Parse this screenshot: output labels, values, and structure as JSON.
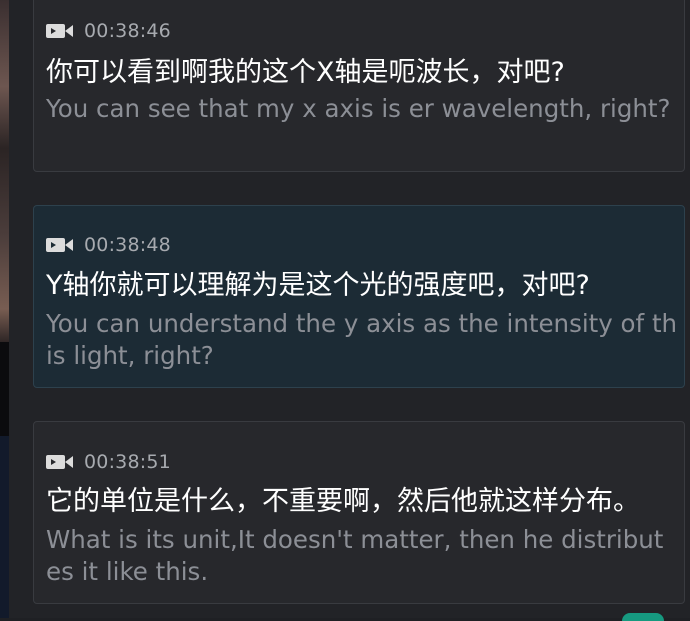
{
  "transcript": {
    "entries": [
      {
        "time": "00:38:46",
        "zh": "你可以看到啊我的这个X轴是呃波长，对吧?",
        "en": "You can see that my x axis is er wavelength, right?",
        "icon": "video-camera-icon",
        "active": false
      },
      {
        "time": "00:38:48",
        "zh": "Y轴你就可以理解为是这个光的强度吧，对吧?",
        "en": "You can understand the y axis as the intensity of this light, right?",
        "icon": "video-camera-icon",
        "active": true
      },
      {
        "time": "00:38:51",
        "zh": "它的单位是什么，不重要啊，然后他就这样分布。",
        "en": "What is its unit,It doesn't matter, then he distributes it like this.",
        "icon": "video-camera-icon",
        "active": false
      }
    ]
  },
  "colors": {
    "panel_background": "#222327",
    "card_background": "#27282c",
    "active_card_background": "#1c2b35",
    "primary_text": "#ffffff",
    "secondary_text": "#8c8f96",
    "timestamp_text": "#a7aaaf",
    "accent": "#16a085"
  }
}
